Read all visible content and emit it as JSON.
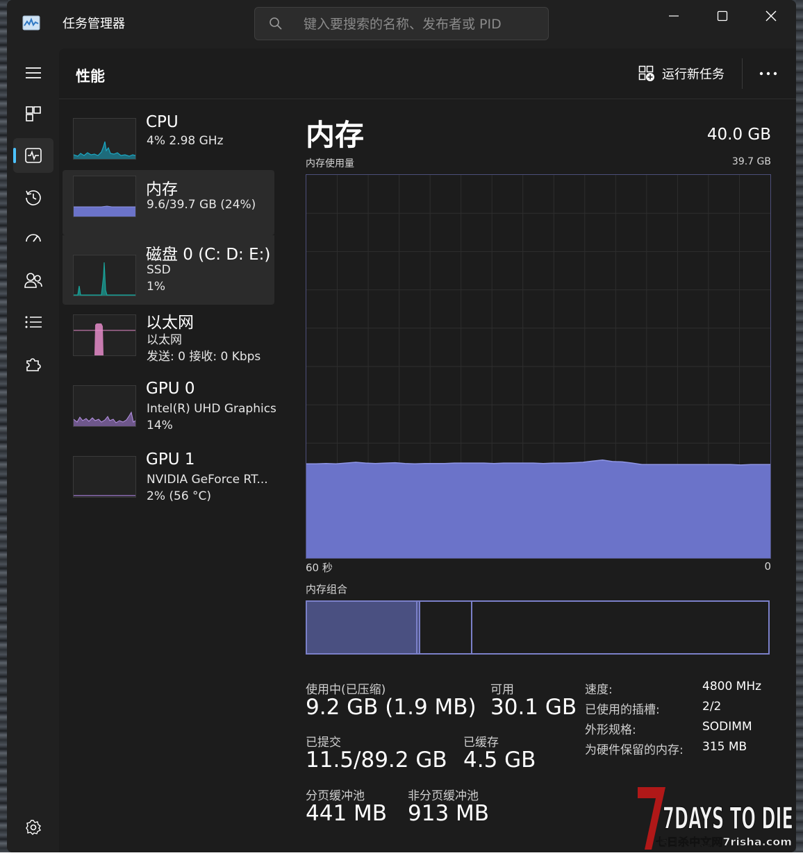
{
  "app": {
    "title": "任务管理器"
  },
  "search": {
    "placeholder": "键入要搜索的名称、发布者或 PID"
  },
  "header": {
    "title": "性能",
    "run_task": "运行新任务"
  },
  "devices": [
    {
      "name": "CPU",
      "line1": "4%  2.98 GHz",
      "line2": ""
    },
    {
      "name": "内存",
      "line1": "9.6/39.7 GB (24%)",
      "line2": ""
    },
    {
      "name": "磁盘 0 (C: D: E:)",
      "line1": "SSD",
      "line2": "1%"
    },
    {
      "name": "以太网",
      "line1": "以太网",
      "line2": "发送: 0  接收: 0 Kbps"
    },
    {
      "name": "GPU 0",
      "line1": "Intel(R) UHD Graphics",
      "line2": "14%"
    },
    {
      "name": "GPU 1",
      "line1": "NVIDIA GeForce RT...",
      "line2": "2%  (56 °C)"
    }
  ],
  "memory": {
    "title": "内存",
    "total": "40.0 GB",
    "usage_label": "内存使用量",
    "usage_max": "39.7 GB",
    "axis_left": "60 秒",
    "axis_right": "0",
    "composition_label": "内存组合",
    "usage_history_pct": [
      24.6,
      24.6,
      24.7,
      24.6,
      24.8,
      25.0,
      24.8,
      24.7,
      24.8,
      24.9,
      24.7,
      24.6,
      24.7,
      24.7,
      24.7,
      24.8,
      24.8,
      24.8,
      24.8,
      24.7,
      24.8,
      24.8,
      24.8,
      24.8,
      24.7,
      24.8,
      24.8,
      24.9,
      25.0,
      25.3,
      25.6,
      25.2,
      25.1,
      24.8,
      24.4,
      24.4,
      24.4,
      24.4,
      24.4,
      24.4,
      24.4,
      24.4,
      24.4,
      24.4,
      24.3,
      24.4,
      24.4,
      24.4
    ],
    "composition": {
      "in_use_pct": 23.7,
      "modified_pct": 0.6,
      "standby_pct": 11.3
    },
    "stats": {
      "in_use_label": "使用中(已压缩)",
      "in_use_value": "9.2 GB (1.9 MB)",
      "available_label": "可用",
      "available_value": "30.1 GB",
      "committed_label": "已提交",
      "committed_value": "11.5/89.2 GB",
      "cached_label": "已缓存",
      "cached_value": "4.5 GB",
      "paged_label": "分页缓冲池",
      "paged_value": "441 MB",
      "nonpaged_label": "非分页缓冲池",
      "nonpaged_value": "913 MB"
    },
    "specs": [
      {
        "key": "速度:",
        "value": "4800 MHz"
      },
      {
        "key": "已使用的插槽:",
        "value": "2/2"
      },
      {
        "key": "外形规格:",
        "value": "SODIMM"
      },
      {
        "key": "为硬件保留的内存:",
        "value": "315 MB"
      }
    ]
  },
  "watermark": {
    "text1": "7DAYS TO DIE",
    "text2": "七日杀中文网7risha.com"
  },
  "colors": {
    "accent": "#4cc2ff",
    "memory": "#6b73c9",
    "cpu": "#1ba8c4",
    "disk": "#1aa39a",
    "network": "#e58bc9",
    "gpu": "#a07ad0"
  }
}
